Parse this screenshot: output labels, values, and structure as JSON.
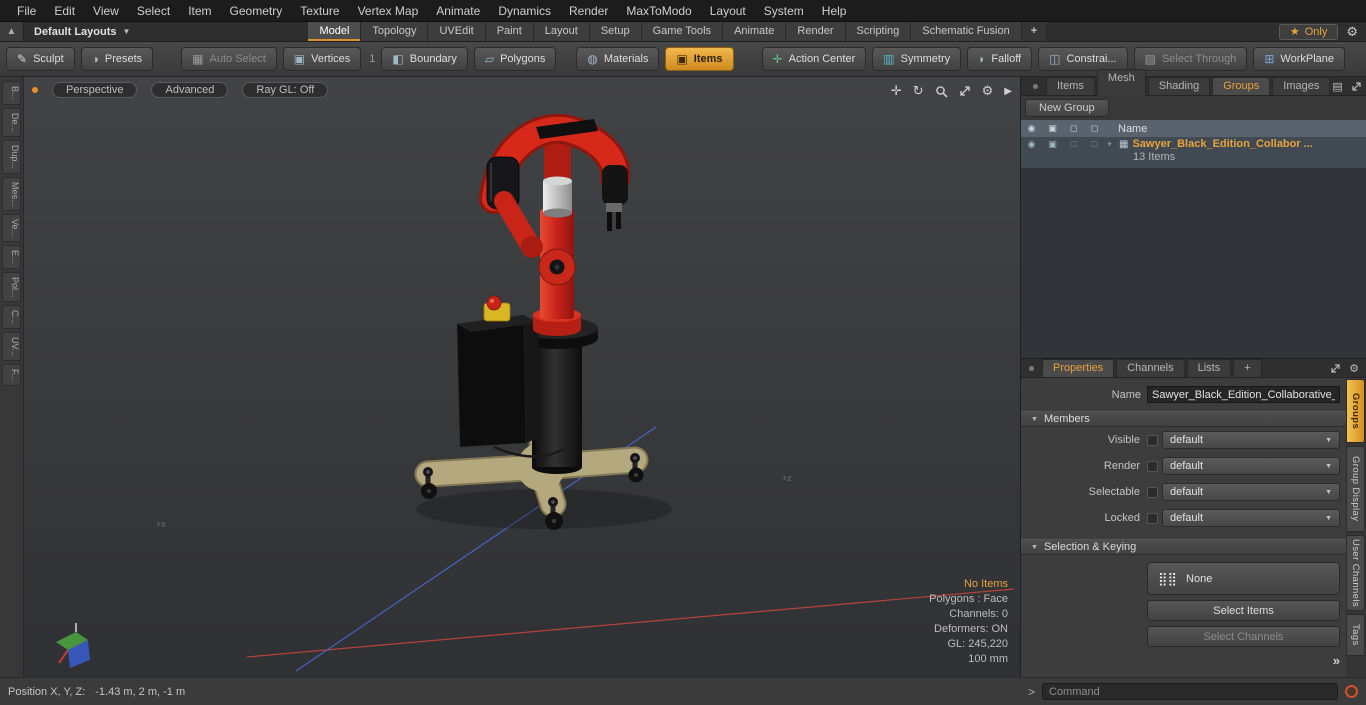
{
  "menubar": {
    "items": [
      "File",
      "Edit",
      "View",
      "Select",
      "Item",
      "Geometry",
      "Texture",
      "Vertex Map",
      "Animate",
      "Dynamics",
      "Render",
      "MaxToModo",
      "Layout",
      "System",
      "Help"
    ]
  },
  "layout_bar": {
    "layouts_label": "Default Layouts",
    "tabs": [
      "Model",
      "Topology",
      "UVEdit",
      "Paint",
      "Layout",
      "Setup",
      "Game Tools",
      "Animate",
      "Render",
      "Scripting",
      "Schematic Fusion"
    ],
    "plus_label": "+",
    "only_label": "Only"
  },
  "toolbar": {
    "sculpt": "Sculpt",
    "presets": "Presets",
    "auto_select": "Auto Select",
    "vertices": "Vertices",
    "vertices_count": "1",
    "boundary": "Boundary",
    "polygons": "Polygons",
    "materials": "Materials",
    "items": "Items",
    "action_center": "Action Center",
    "symmetry": "Symmetry",
    "falloff": "Falloff",
    "constraints": "Constrai...",
    "select_through": "Select Through",
    "workplane": "WorkPlane"
  },
  "left_strip": {
    "tabs": [
      "B...",
      "De...",
      "Dup...",
      "Mes...",
      "Ve...",
      "E...",
      "Pol...",
      "C...",
      "UV...",
      "F..."
    ]
  },
  "viewport": {
    "mode_tab": "Perspective",
    "shading_tab": "Advanced",
    "raygl_tab": "Ray GL: Off",
    "stats": {
      "no_items": "No Items",
      "polygons": "Polygons : Face",
      "channels": "Channels: 0",
      "deformers": "Deformers: ON",
      "gl": "GL: 245,220",
      "scale": "100 mm"
    },
    "axis_labels": {
      "x": "+x",
      "z": "+z"
    }
  },
  "groups_panel": {
    "tabs": [
      "Items",
      "Mesh ...",
      "Shading",
      "Groups",
      "Images"
    ],
    "new_group_label": "New Group",
    "name_header": "Name",
    "row": {
      "name": "Sawyer_Black_Edition_Collabor ...",
      "count": "13 Items"
    }
  },
  "properties_panel": {
    "tabs": [
      "Properties",
      "Channels",
      "Lists",
      "+"
    ],
    "name_label": "Name",
    "name_value": "Sawyer_Black_Edition_Collaborative_F",
    "members_header": "Members",
    "fields": [
      {
        "label": "Visible",
        "value": "default"
      },
      {
        "label": "Render",
        "value": "default"
      },
      {
        "label": "Selectable",
        "value": "default"
      },
      {
        "label": "Locked",
        "value": "default"
      }
    ],
    "selection_header": "Selection & Keying",
    "none_label": "None",
    "select_items_label": "Select Items",
    "select_channels_label": "Select Channels",
    "side_tabs": [
      "Groups",
      "Group Display",
      "User Channels",
      "Tags"
    ],
    "expand_label": "»"
  },
  "statusbar": {
    "position_label": "Position X, Y, Z:",
    "position_value": "-1.43 m, 2 m, -1 m",
    "command_placeholder": "Command"
  }
}
